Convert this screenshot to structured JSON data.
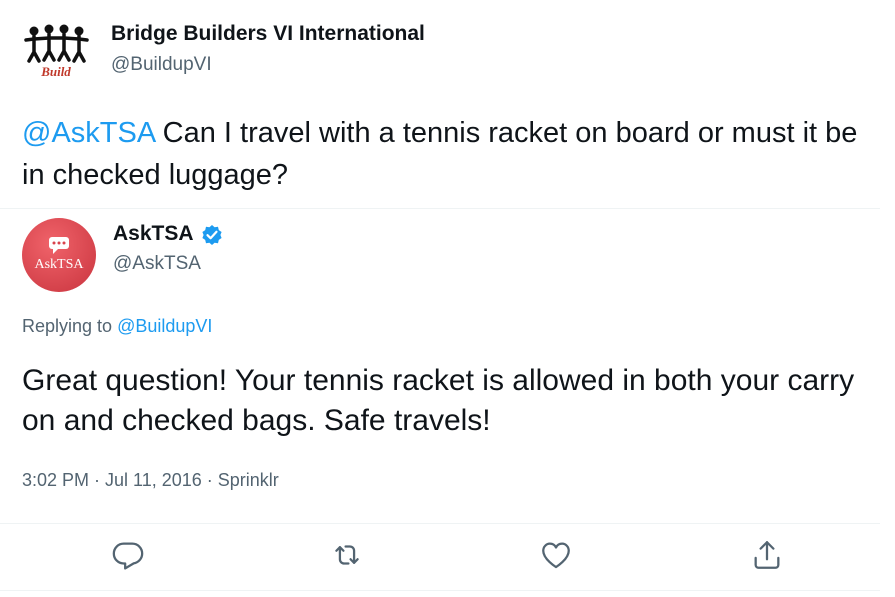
{
  "original_tweet": {
    "display_name": "Bridge Builders VI International",
    "handle": "@BuildupVI",
    "mention": "@AskTSA",
    "text": "Can I travel with a tennis racket on board or must it be in checked luggage?",
    "avatar_icon": "bridge-builders-logo-icon",
    "avatar_logo_text": "Build"
  },
  "reply_tweet": {
    "display_name": "AskTSA",
    "handle": "@AskTSA",
    "verified_icon": "verified-badge-icon",
    "avatar_icon": "asktsa-logo-icon",
    "avatar_logo_text": "AskTSA",
    "replying_prefix": "Replying to",
    "replying_to": "@BuildupVI",
    "text": "Great question! Your tennis racket is allowed in both your carry on and checked bags. Safe travels!",
    "timestamp": "3:02 PM · Jul 11, 2016 · Sprinklr"
  },
  "actions": [
    {
      "name": "reply",
      "icon": "reply-icon"
    },
    {
      "name": "retweet",
      "icon": "retweet-icon"
    },
    {
      "name": "like",
      "icon": "heart-icon"
    },
    {
      "name": "share",
      "icon": "share-icon"
    }
  ],
  "colors": {
    "text_primary": "#0f1419",
    "text_secondary": "#536471",
    "accent": "#1d9bf0",
    "divider": "#eff3f4",
    "tsa_avatar": "#d9434c",
    "bb_logo_red": "#c0392b"
  }
}
